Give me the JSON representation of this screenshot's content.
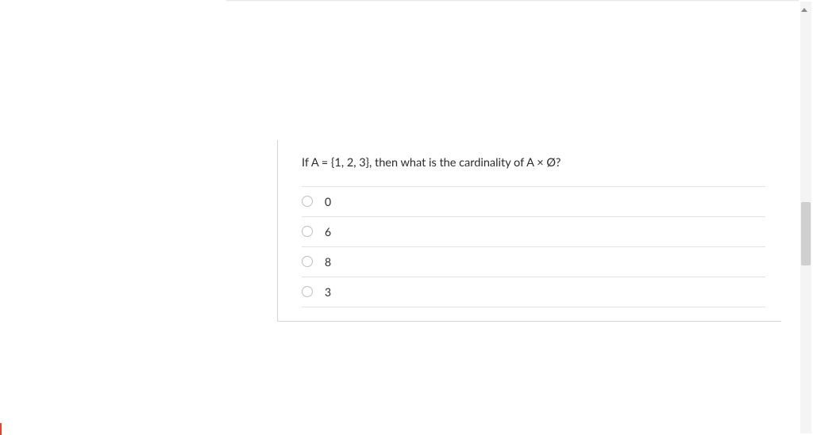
{
  "question": {
    "text": "If A = {1, 2, 3}, then what is the cardinality of A × Ø?",
    "options": [
      {
        "label": "0"
      },
      {
        "label": "6"
      },
      {
        "label": "8"
      },
      {
        "label": "3"
      }
    ]
  }
}
